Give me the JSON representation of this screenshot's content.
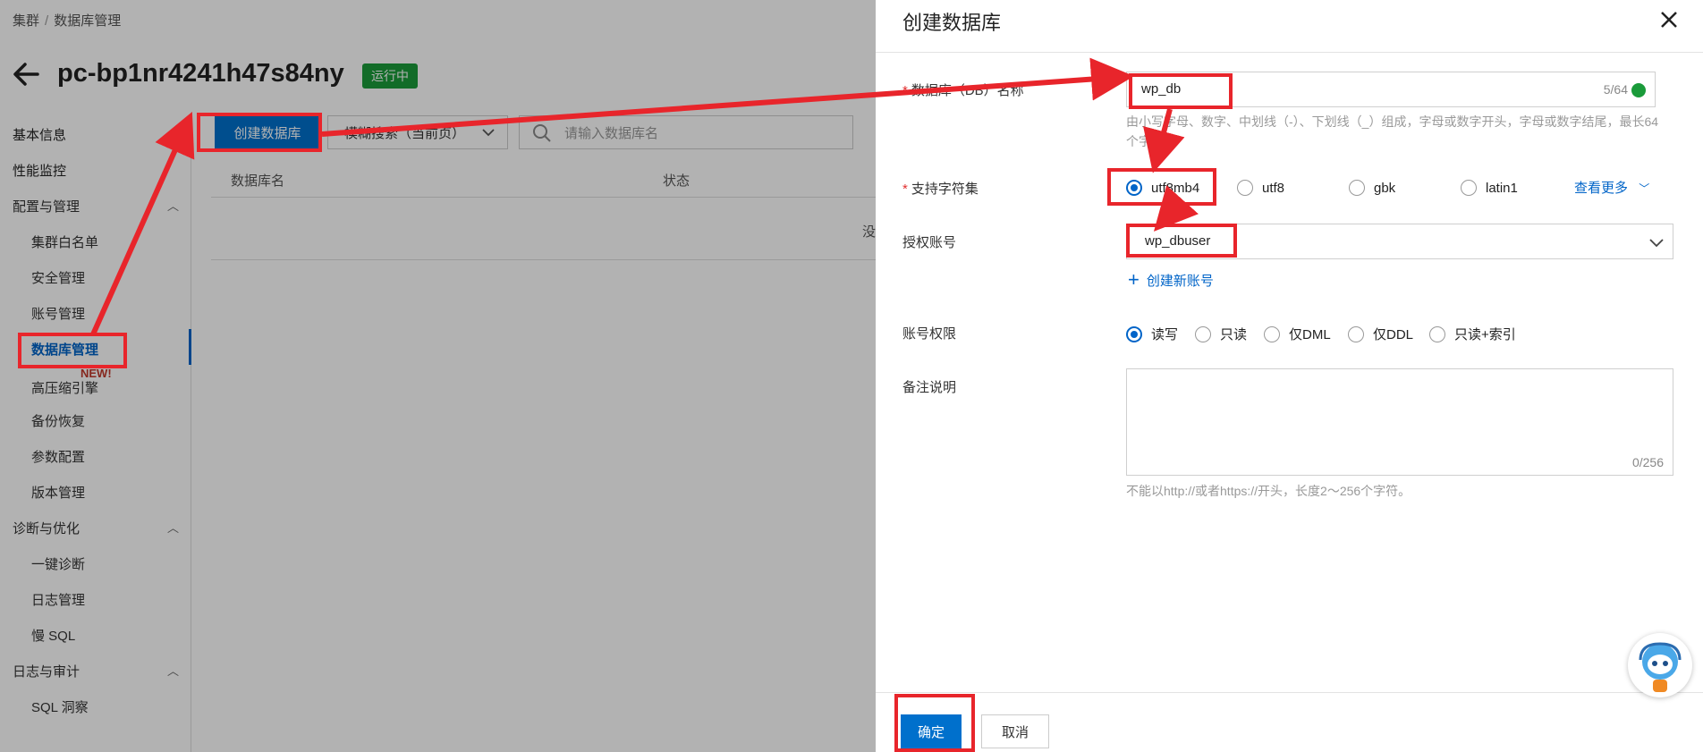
{
  "breadcrumb": {
    "root": "集群",
    "separator": "/",
    "current": "数据库管理"
  },
  "cluster": {
    "title": "pc-bp1nr4241h47s84ny",
    "status": "运行中"
  },
  "sidebar": {
    "items": [
      {
        "label": "基本信息"
      },
      {
        "label": "性能监控"
      }
    ],
    "groups": [
      {
        "label": "配置与管理",
        "items": [
          "集群白名单",
          "安全管理",
          "账号管理",
          "数据库管理",
          "高压缩引擎",
          "备份恢复",
          "参数配置",
          "版本管理"
        ]
      },
      {
        "label": "诊断与优化",
        "items": [
          "一键诊断",
          "日志管理",
          "慢 SQL"
        ]
      },
      {
        "label": "日志与审计",
        "items": [
          "SQL 洞察"
        ]
      }
    ],
    "new_tag": "NEW!"
  },
  "toolbar": {
    "create_button": "创建数据库",
    "filter_select": "模糊搜索（当前页）",
    "search_placeholder": "请输入数据库名"
  },
  "table": {
    "columns": [
      "数据库名",
      "状态"
    ],
    "empty_text": "没"
  },
  "drawer": {
    "title": "创建数据库",
    "db_name": {
      "label": "数据库（DB）名称",
      "value": "wp_db",
      "count": "5/64",
      "hint": "由小写字母、数字、中划线（-）、下划线（_）组成，字母或数字开头，字母或数字结尾，最长64个字符"
    },
    "charset": {
      "label": "支持字符集",
      "options": [
        "utf8mb4",
        "utf8",
        "gbk",
        "latin1"
      ],
      "selected": "utf8mb4",
      "more": "查看更多"
    },
    "account": {
      "label": "授权账号",
      "value": "wp_dbuser",
      "create_link": "创建新账号"
    },
    "permission": {
      "label": "账号权限",
      "options": [
        "读写",
        "只读",
        "仅DML",
        "仅DDL",
        "只读+索引"
      ],
      "selected": "读写"
    },
    "remark": {
      "label": "备注说明",
      "count": "0/256",
      "hint": "不能以http://或者https://开头，长度2～256个字符。"
    },
    "ok_button": "确定",
    "cancel_button": "取消"
  },
  "colors": {
    "primary": "#0070cc",
    "annotation": "#e8252b",
    "success": "#1a9b3a"
  }
}
